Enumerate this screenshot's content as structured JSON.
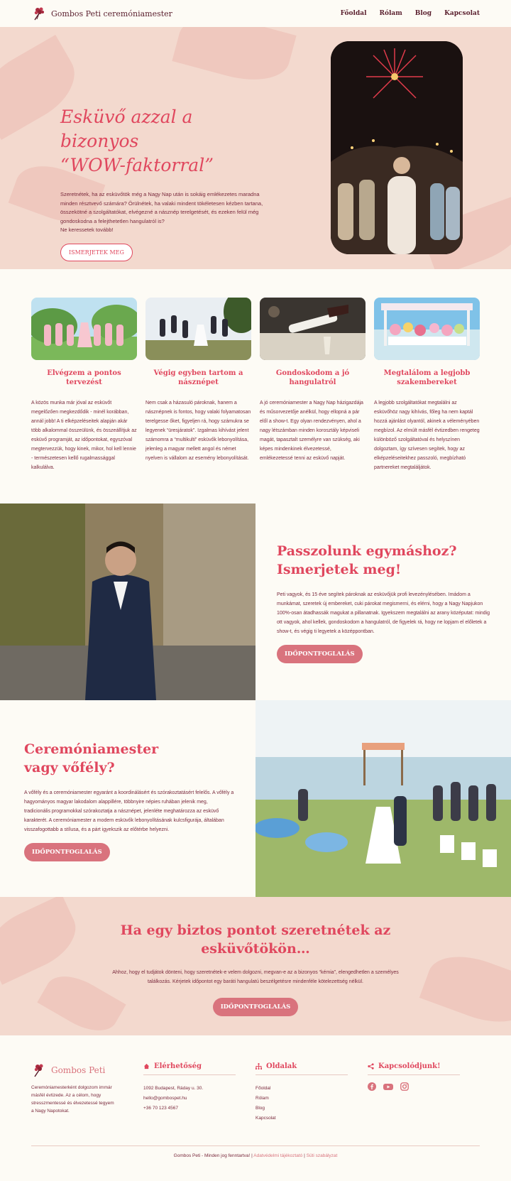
{
  "header": {
    "brand": "Gombos Peti ceremóniamester",
    "nav": [
      "Főoldal",
      "Rólam",
      "Blog",
      "Kapcsolat"
    ]
  },
  "hero": {
    "title_line1": "Esküvő azzal a bizonyos",
    "title_line2": "“WOW-faktorral”",
    "body": "Szeretnétek, ha az esküvőtök még a Nagy Nap után is sokáig emlékezetes maradna minden résztvevő számára? Örülnétek, ha valaki mindent tökéletesen kézben tartana, összekötné a szolgáltatókat, elvégezné a násznép terelgetését, és ezeken felül még gondoskodna a felejthetetlen hangulatról is?",
    "body2": "Ne keressetek tovább!",
    "button": "ISMERJETEK MEG"
  },
  "services": [
    {
      "title": "Elvégzem a pontos tervezést",
      "body": "A közös munka már jóval az esküvőt megelőzően megkezdődik - minél korábban, annál jobb! A ti elképzeléseitek alapján akár több alkalommal összeülünk, és összeállítjuk az esküvő programját, az időpontokat, egyszóval megtervezzük, hogy kinek, mikor, hol kell lennie - természetesen kellő rugalmassággal kalkulálva."
    },
    {
      "title": "Végig egyben tartom a násznépet",
      "body": "Nem csak a házasuló pároknak, hanem a násznépnek is fontos, hogy valaki folyamatosan terelgesse őket, figyeljen rá, hogy számukra se legyenek “üresjáratok”. Izgalmas kihívást jelent számomra a “multikulti” esküvők lebonyolítása, jelenleg a magyar mellett angol és német nyelven is vállalom az esemény lebonyolítását."
    },
    {
      "title": "Gondoskodom a jó hangulatról",
      "body": "A jó ceremóniamester a Nagy Nap házigazdája és műsorvezetője anélkül, hogy ellopná a pár elől a show-t. Egy olyan rendezvényen, ahol a nagy létszámban minden korosztály képviseli magát, tapasztalt személyre van szükség, aki képes mindenkinek élvezetessé, emlékezetessé tenni az esküvő napját."
    },
    {
      "title": "Megtalálom a legjobb szakembereket",
      "body": "A legjobb szolgáltatókat megtalálni az esküvőhöz nagy kihívás, főleg ha nem kaptál hozzá ajánlást olyantól, akinek a véleményében megbízol. Az elmúlt másfél évtizedben rengeteg különböző szolgáltatóval és helyszínen dolgoztam, így szívesen segítek, hogy az elképzeléseitekhez passzoló, megbízható partnereket megtaláljátok."
    }
  ],
  "about": {
    "title_line1": "Passzolunk egymáshoz?",
    "title_line2": "Ismerjetek meg!",
    "body": "Peti vagyok, és 15 éve segítek pároknak az esküvőjük profi levezénylésében. Imádom a munkámat, szeretek új embereket, cuki párokat megismerni, és elérni, hogy a Nagy Napjukon 100%-osan átadhassák magukat a pillanatnak. Igyekszem megtalálni az arany középutat: mindig ott vagyok, ahol kellek, gondoskodom a hangulatról, de figyelek rá, hogy ne lopjam el előletek a show-t, és végig ti legyetek a középpontban.",
    "button": "IDŐPONTFOGLALÁS"
  },
  "vofely": {
    "title_line1": "Ceremóniamester",
    "title_line2": "vagy vőfély?",
    "body": "A vőfély és a ceremóniamester egyaránt a koordinálásért és szórakoztatásért felelős. A vőfély a hagyományos magyar lakodalom alappillére, többnyire népies ruhában jelenik meg, tradicionális programokkal szórakoztatja a násznépet, jelenléte meghatározza az esküvő karakterét. A ceremóniamester a modern esküvők lebonyolításának kulcsfigurája, általában visszafogottabb a stílusa, és a párt igyekszik az előtérbe helyezni.",
    "button": "IDŐPONTFOGLALÁS"
  },
  "cta": {
    "title_line1": "Ha egy biztos pontot szeretnétek az",
    "title_line2": "esküvőtökön…",
    "body": "Ahhoz, hogy el tudjátok dönteni, hogy szeretnétek-e velem dolgozni, megvan-e az a bizonyos “kémia”, elengedhetlen a személyes találkozás. Kérjetek időpontot egy baráti hangulatú beszélgetésre mindenféle kötelezettség nélkül.",
    "button": "IDŐPONTFOGLALÁS"
  },
  "footer": {
    "brand": "Gombos Peti",
    "brand_desc": "Ceremóniamesterként dolgozom immár másfél évtizede. Az a célom, hogy stresszmentessé és élvezetessé tegyem a Nagy Napotokat.",
    "contact_title": "Elérhetőség",
    "address": "1092 Budapest, Ráday u. 30.",
    "email": "hello@gombospet.hu",
    "phone": "+36 70 123 4567",
    "pages_title": "Oldalak",
    "pages": [
      "Főoldal",
      "Rólam",
      "Blog",
      "Kapcsolat"
    ],
    "social_title": "Kapcsolódjunk!",
    "copyright": "Gombos Peti - Minden jog fenntartva!",
    "privacy": "Adatvédelmi tájékoztató",
    "cookies": "Süti szabályzat"
  },
  "colors": {
    "accent": "#e0475e",
    "button": "#d9737d",
    "blush": "#f3d9ce",
    "cream": "#fdfbf5",
    "text": "#7a2a3d"
  }
}
